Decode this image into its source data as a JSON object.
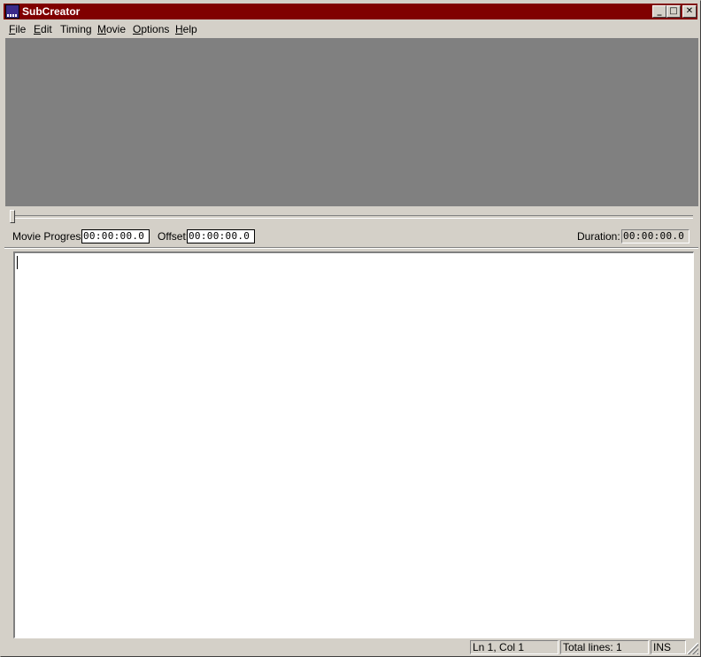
{
  "window": {
    "title": "SubCreator"
  },
  "title_buttons": {
    "minimize": "_",
    "maximize": "□",
    "close": "✕"
  },
  "menu": [
    {
      "label": "File",
      "underline": "F",
      "rest": "ile"
    },
    {
      "label": "Edit",
      "underline": "E",
      "rest": "dit"
    },
    {
      "label": "Timing",
      "underline": "",
      "rest": "Timing"
    },
    {
      "label": "Movie",
      "underline": "M",
      "rest": "ovie"
    },
    {
      "label": "Options",
      "underline": "O",
      "rest": "ptions"
    },
    {
      "label": "Help",
      "underline": "H",
      "rest": "elp"
    }
  ],
  "timing": {
    "movie_progress_label": "Movie Progress:",
    "movie_progress_value": "00:00:00.0",
    "offset_label": "Offset:",
    "offset_value": "00:00:00.0",
    "duration_label": "Duration:",
    "duration_value": "00:00:00.0"
  },
  "seek": {
    "position": 0
  },
  "editor": {
    "text": ""
  },
  "status": {
    "position": "Ln 1, Col 1",
    "total_lines": "Total lines: 1",
    "mode": "INS"
  },
  "colors": {
    "titlebar": "#800000",
    "video_background": "#808080",
    "chrome": "#d4d0c8"
  }
}
